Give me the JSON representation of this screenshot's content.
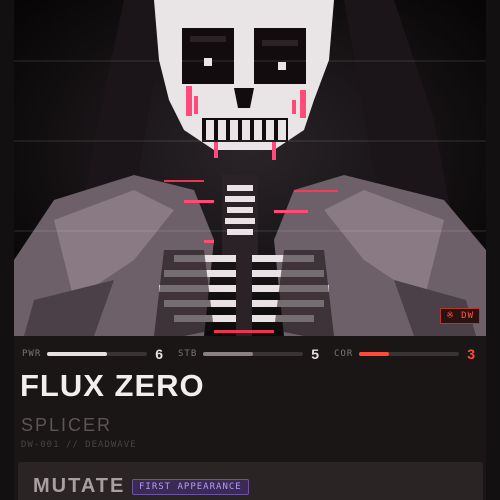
{
  "card": {
    "badge": "※ DW",
    "name": "FLUX ZERO",
    "class": "SPLICER",
    "meta": "DW-001 // DEADWAVE",
    "stats": [
      {
        "label": "PWR",
        "value": "6",
        "fill": 0.6,
        "color": "#e6e0e0"
      },
      {
        "label": "STB",
        "value": "5",
        "fill": 0.5,
        "color": "#8a8282"
      },
      {
        "label": "COR",
        "value": "3",
        "fill": 0.3,
        "color": "#ff4a3a"
      }
    ],
    "ability": {
      "name": "MUTATE",
      "tag": "FIRST APPEARANCE"
    }
  },
  "colors": {
    "accent_red": "#ff4a3a",
    "accent_purple": "#b89cf0",
    "background": "#1a1616"
  },
  "art": {
    "subject": "skull-figure-illustration"
  }
}
